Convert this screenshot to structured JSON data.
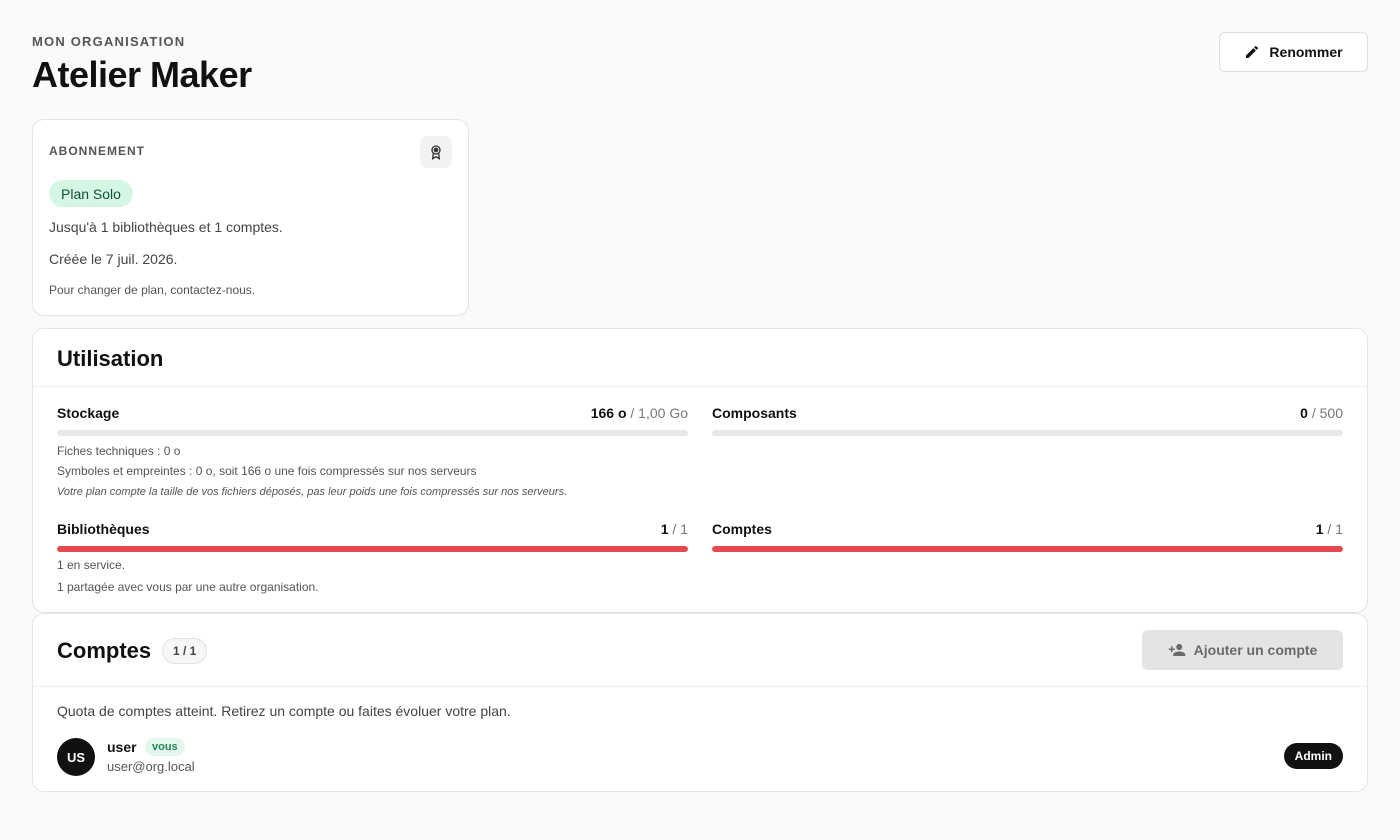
{
  "header": {
    "kicker": "MON ORGANISATION",
    "title": "Atelier Maker",
    "rename_label": "Renommer"
  },
  "subscription": {
    "label": "ABONNEMENT",
    "plan": "Plan Solo",
    "limits": "Jusqu'à 1 bibliothèques et 1 comptes.",
    "created": "Créée le 7 juil. 2026.",
    "note": "Pour changer de plan, contactez-nous.",
    "icon": "award-icon"
  },
  "usage": {
    "title": "Utilisation",
    "storage": {
      "name": "Stockage",
      "used": "166 o",
      "total": "/ 1,00 Go",
      "fill": 0.0,
      "datasheets": "Fiches techniques : 0 o",
      "symbols": "Symboles et empreintes : 0 o, soit 166 o une fois compressés sur nos serveurs",
      "note": "Votre plan compte la taille de vos fichiers déposés, pas leur poids une fois compressés sur nos serveurs."
    },
    "components": {
      "name": "Composants",
      "used": "0",
      "total": "/ 500",
      "fill": 0.0
    },
    "libraries": {
      "name": "Bibliothèques",
      "used": "1",
      "total": "/ 1",
      "fill": 1.0,
      "in_service": "1 en service.",
      "shared": "1 partagée avec vous par une autre organisation."
    },
    "accounts": {
      "name": "Comptes",
      "used": "1",
      "total": "/ 1",
      "fill": 1.0
    }
  },
  "accounts": {
    "title": "Comptes",
    "count": "1 / 1",
    "add_label": "Ajouter un compte",
    "quota_message": "Quota de comptes atteint. Retirez un compte ou faites évoluer votre plan.",
    "users": [
      {
        "initials": "US",
        "name": "user",
        "you": "vous",
        "email": "user@org.local",
        "role": "Admin"
      }
    ]
  },
  "colors": {
    "bar_full": "#e5484d",
    "bar_track": "#e8e8e8",
    "plan_badge_bg": "#d5f6e4"
  }
}
